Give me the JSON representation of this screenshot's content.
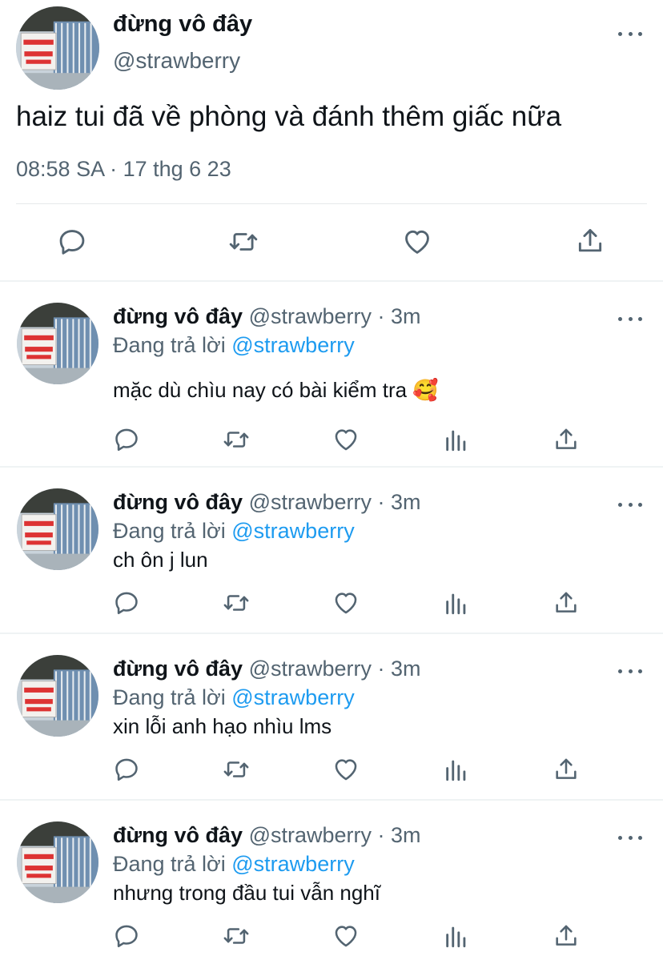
{
  "main_tweet": {
    "display_name": "đừng vô đây",
    "handle": "@strawberry",
    "text": "haiz tui đã về phòng và đánh thêm giấc nữa",
    "timestamp": "08:58 SA · 17 thg 6 23",
    "avatar_sign_text": "KHÔNG TIẾP NGƯỜI XÀM L",
    "actions": [
      "reply-icon",
      "retweet-icon",
      "like-icon",
      "share-icon"
    ]
  },
  "replies": [
    {
      "display_name": "đừng vô đây",
      "handle_time": " @strawberry · 3m",
      "replying_prefix": "Đang trả lời ",
      "replying_to": "@strawberry",
      "text": "mặc dù chìu nay có bài kiểm tra 🥰"
    },
    {
      "display_name": "đừng vô đây",
      "handle_time": " @strawberry · 3m",
      "replying_prefix": "Đang trả lời ",
      "replying_to": "@strawberry",
      "text": "ch ôn j lun"
    },
    {
      "display_name": "đừng vô đây",
      "handle_time": " @strawberry · 3m",
      "replying_prefix": "Đang trả lời ",
      "replying_to": "@strawberry",
      "text": "xin lỗi anh hạo nhìu lms"
    },
    {
      "display_name": "đừng vô đây",
      "handle_time": " @strawberry · 3m",
      "replying_prefix": "Đang trả lời ",
      "replying_to": "@strawberry",
      "text": "nhưng trong đầu tui vẫn nghĩ"
    }
  ],
  "colors": {
    "text": "#0f1419",
    "secondary": "#536471",
    "accent": "#1d9bf0",
    "divider": "#eff3f4"
  }
}
